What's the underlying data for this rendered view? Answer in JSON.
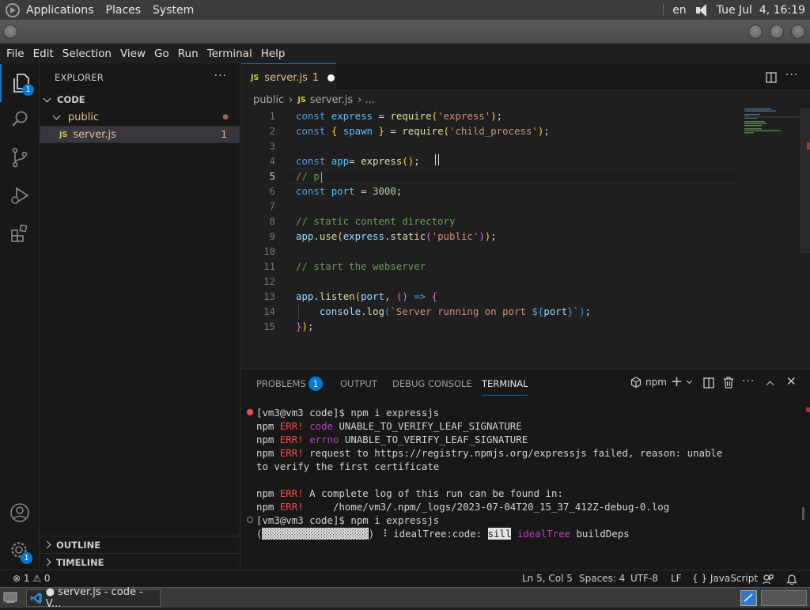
{
  "topbar": {
    "menus": [
      "Applications",
      "Places",
      "System"
    ],
    "lang": "en",
    "clock": "Tue Jul  4, 16:19"
  },
  "menubar": [
    "File",
    "Edit",
    "Selection",
    "View",
    "Go",
    "Run",
    "Terminal",
    "Help"
  ],
  "activity": {
    "explorer_badge": "1",
    "accounts_badge": "1"
  },
  "sidebar": {
    "title": "EXPLORER",
    "more": "···",
    "folder": "CODE",
    "items": [
      {
        "label": "public",
        "status": "●"
      },
      {
        "icon": "JS",
        "label": "server.js",
        "status": "1"
      }
    ],
    "outline": "OUTLINE",
    "timeline": "TIMELINE"
  },
  "editor": {
    "tab": {
      "icon": "JS",
      "label": "server.js",
      "count": "1"
    },
    "breadcrumb": {
      "folder": "public",
      "sep": "›",
      "icon": "JS",
      "file": "server.js",
      "tail": "› ..."
    },
    "current_line": 5,
    "lines": [
      [
        [
          "kw",
          "const "
        ],
        [
          "var",
          "express"
        ],
        [
          "pl",
          " = "
        ],
        [
          "fn",
          "require"
        ],
        [
          "br1",
          "("
        ],
        [
          "str",
          "'express'"
        ],
        [
          "br1",
          ")"
        ],
        [
          "pl",
          ";"
        ]
      ],
      [
        [
          "kw",
          "const "
        ],
        [
          "br1",
          "{ "
        ],
        [
          "var",
          "spawn"
        ],
        [
          "br1",
          " }"
        ],
        [
          "pl",
          " = "
        ],
        [
          "fn",
          "require"
        ],
        [
          "br1",
          "("
        ],
        [
          "str",
          "'child_process'"
        ],
        [
          "br1",
          ")"
        ],
        [
          "pl",
          ";"
        ]
      ],
      [],
      [
        [
          "kw",
          "const "
        ],
        [
          "var",
          "app"
        ],
        [
          "pl",
          "= "
        ],
        [
          "fn",
          "express"
        ],
        [
          "br1",
          "()"
        ],
        [
          "pl",
          ";"
        ]
      ],
      [
        [
          "cm",
          "// p"
        ]
      ],
      [
        [
          "kw",
          "const "
        ],
        [
          "var",
          "port"
        ],
        [
          "pl",
          " = "
        ],
        [
          "num",
          "3000"
        ],
        [
          "pl",
          ";"
        ]
      ],
      [],
      [
        [
          "cm",
          "// static content directory"
        ]
      ],
      [
        [
          "prop",
          "app"
        ],
        [
          "pl",
          "."
        ],
        [
          "fn",
          "use"
        ],
        [
          "br1",
          "("
        ],
        [
          "prop",
          "express"
        ],
        [
          "pl",
          "."
        ],
        [
          "fn",
          "static"
        ],
        [
          "br2",
          "("
        ],
        [
          "str",
          "'public'"
        ],
        [
          "br2",
          ")"
        ],
        [
          "br1",
          ")"
        ],
        [
          "pl",
          ";"
        ]
      ],
      [],
      [
        [
          "cm",
          "// start the webserver"
        ]
      ],
      [],
      [
        [
          "prop",
          "app"
        ],
        [
          "pl",
          "."
        ],
        [
          "fn",
          "listen"
        ],
        [
          "br1",
          "("
        ],
        [
          "prop",
          "port"
        ],
        [
          "pl",
          ", "
        ],
        [
          "br2",
          "()"
        ],
        [
          "pl",
          " "
        ],
        [
          "kw",
          "=>"
        ],
        [
          "pl",
          " "
        ],
        [
          "br2",
          "{"
        ]
      ],
      [
        [
          "pl",
          "    "
        ],
        [
          "prop",
          "console"
        ],
        [
          "pl",
          "."
        ],
        [
          "fn",
          "log"
        ],
        [
          "br3",
          "("
        ],
        [
          "str",
          "`Server running on port "
        ],
        [
          "kw",
          "${"
        ],
        [
          "prop",
          "port"
        ],
        [
          "kw",
          "}"
        ],
        [
          "str",
          "`"
        ],
        [
          "br3",
          ")"
        ],
        [
          "pl",
          ";"
        ]
      ],
      [
        [
          "br2",
          "}"
        ],
        [
          "br1",
          ")"
        ],
        [
          "pl",
          ";"
        ]
      ]
    ]
  },
  "panel": {
    "tabs": [
      "PROBLEMS",
      "OUTPUT",
      "DEBUG CONSOLE",
      "TERMINAL"
    ],
    "problems_count": "1",
    "active_tab": "TERMINAL",
    "shell": "npm",
    "terminal": [
      {
        "marker": "err",
        "parts": [
          [
            "pl",
            "[vm3@vm3 code]$ npm i expressjs"
          ]
        ]
      },
      {
        "parts": [
          [
            "pl",
            "npm "
          ],
          [
            "err",
            "ERR!"
          ],
          [
            "pl",
            " "
          ],
          [
            "mg",
            "code"
          ],
          [
            "pl",
            " UNABLE_TO_VERIFY_LEAF_SIGNATURE"
          ]
        ]
      },
      {
        "parts": [
          [
            "pl",
            "npm "
          ],
          [
            "err",
            "ERR!"
          ],
          [
            "pl",
            " "
          ],
          [
            "mg",
            "errno"
          ],
          [
            "pl",
            " UNABLE_TO_VERIFY_LEAF_SIGNATURE"
          ]
        ]
      },
      {
        "parts": [
          [
            "pl",
            "npm "
          ],
          [
            "err",
            "ERR!"
          ],
          [
            "pl",
            " request to https://registry.npmjs.org/expressjs failed, reason: unable"
          ]
        ]
      },
      {
        "parts": [
          [
            "pl",
            "to verify the first certificate"
          ]
        ]
      },
      {
        "parts": []
      },
      {
        "parts": [
          [
            "pl",
            "npm "
          ],
          [
            "err",
            "ERR!"
          ],
          [
            "pl",
            " A complete log of this run can be found in:"
          ]
        ]
      },
      {
        "parts": [
          [
            "pl",
            "npm "
          ],
          [
            "err",
            "ERR!"
          ],
          [
            "pl",
            "     /home/vm3/.npm/_logs/2023-07-04T20_15_37_412Z-debug-0.log"
          ]
        ]
      },
      {
        "marker": "o",
        "parts": [
          [
            "pl",
            "[vm3@vm3 code]$ npm i expressjs"
          ]
        ]
      },
      {
        "parts": [
          [
            "pl",
            "("
          ],
          [
            "hl",
            "░░░░░░░░░░░░░░░░░░"
          ],
          [
            "pl",
            ") ⠸ idealTree:code: "
          ],
          [
            "hl",
            "sill"
          ],
          [
            "pl",
            " "
          ],
          [
            "mg",
            "idealTree"
          ],
          [
            "pl",
            " buildDeps"
          ]
        ]
      }
    ]
  },
  "statusbar": {
    "errors": "⊗ 1 ⚠ 0",
    "position": "Ln 5, Col 5",
    "spaces": "Spaces: 4",
    "encoding": "UTF-8",
    "eol": "LF",
    "language": "{ } JavaScript"
  },
  "taskbar": {
    "window": "● server.js - code - V..."
  },
  "colors": {
    "accent": "#0078d4",
    "error": "#f14c4c",
    "modified": "#e2c08d"
  }
}
